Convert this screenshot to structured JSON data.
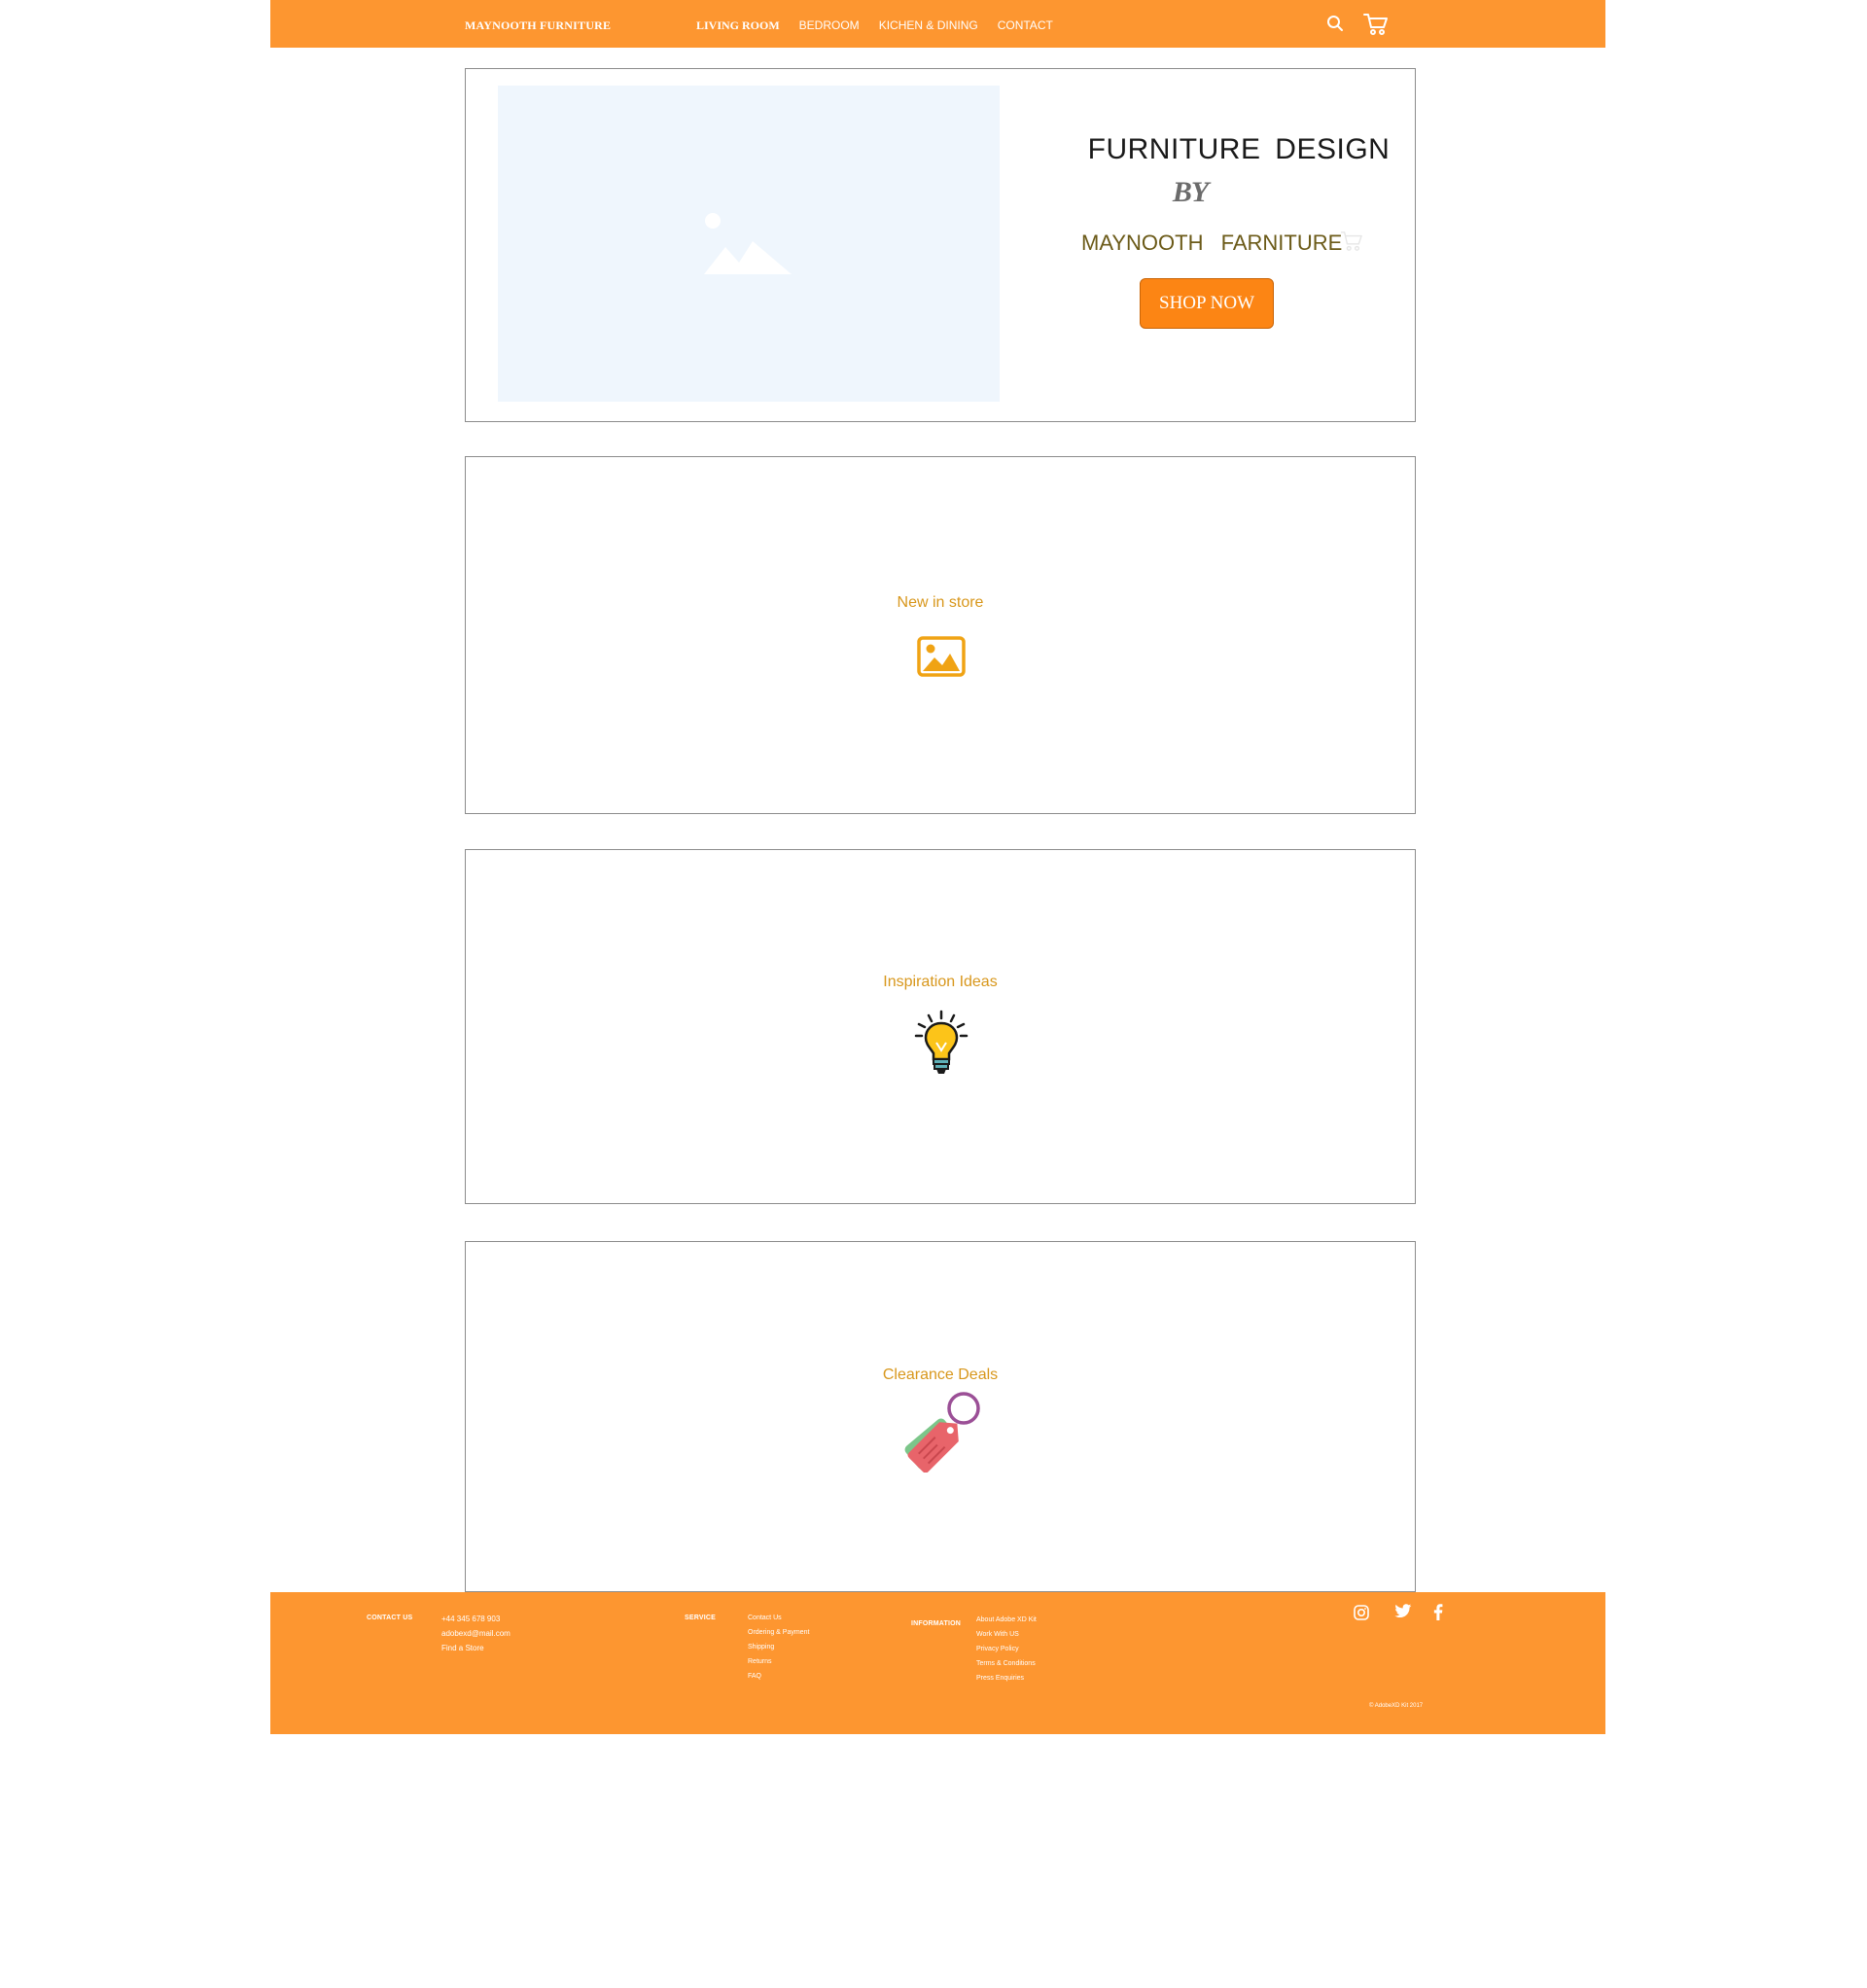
{
  "header": {
    "brand": "MAYNOOTH FURNITURE",
    "nav": [
      "LIVING ROOM",
      "BEDROOM",
      "KICHEN & DINING",
      "CONTACT"
    ],
    "icons": [
      "search-icon",
      "cart-icon"
    ]
  },
  "hero": {
    "title": "FURNITURE  DESIGN",
    "by": "BY",
    "subtitle": "MAYNOOTH  FARNITURE",
    "button": "SHOP NOW",
    "image_placeholder": "image-placeholder-icon"
  },
  "sections": [
    {
      "label": "New in store",
      "icon": "image-icon"
    },
    {
      "label": "Inspiration Ideas",
      "icon": "lightbulb-icon"
    },
    {
      "label": "Clearance Deals",
      "icon": "price-tag-icon"
    }
  ],
  "footer": {
    "contact": {
      "heading": "CONTACT US",
      "items": [
        "+44 345 678 903",
        "adobexd@mail.com",
        "Find a Store"
      ]
    },
    "service": {
      "heading": "SERVICE",
      "items": [
        "Contact Us",
        "Ordering & Payment",
        "Shipping",
        "Returns",
        "FAQ"
      ]
    },
    "information": {
      "heading": "INFORMATION",
      "items": [
        "About Adobe XD Kit",
        "Work With US",
        "Privacy Policy",
        "Terms & Conditions",
        "Press Enquiries"
      ]
    },
    "social": [
      "instagram-icon",
      "twitter-icon",
      "facebook-icon"
    ],
    "copyright": "© AdobeXD Kit 2017"
  },
  "colors": {
    "brand_orange": "#fd9630",
    "button_orange": "#fc8514",
    "section_label": "#d8971c",
    "hero_subtitle": "#6b5a18"
  }
}
